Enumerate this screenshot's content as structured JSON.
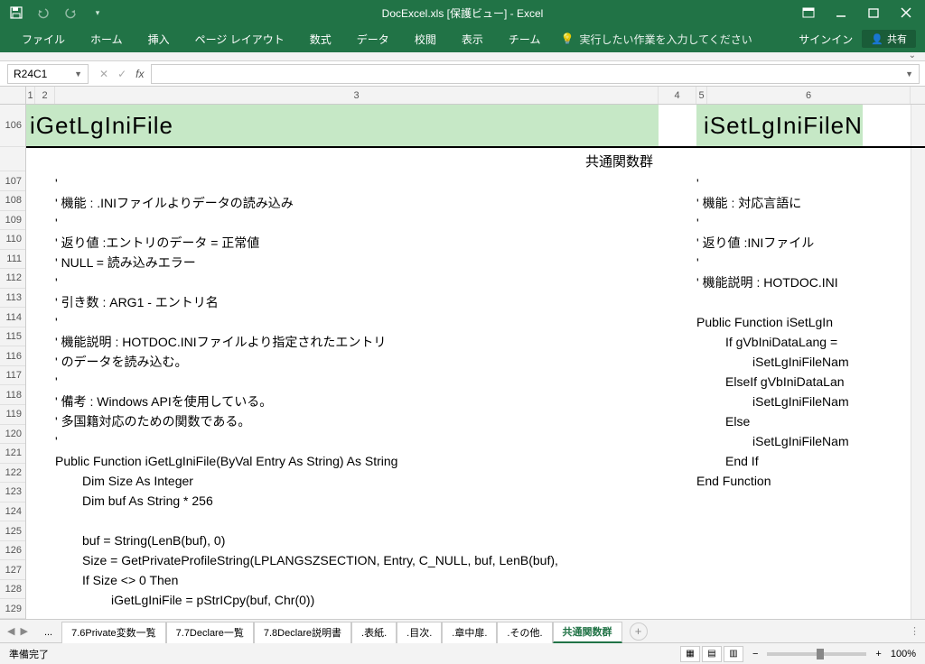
{
  "titlebar": {
    "doc_title": "DocExcel.xls  [保護ビュー] - Excel"
  },
  "ribbon": {
    "tabs": [
      "ファイル",
      "ホーム",
      "挿入",
      "ページ レイアウト",
      "数式",
      "データ",
      "校閲",
      "表示",
      "チーム"
    ],
    "tell_me": "実行したい作業を入力してください",
    "signin": "サインイン",
    "share": "共有"
  },
  "formula": {
    "name_box": "R24C1",
    "fx_value": ""
  },
  "columns": [
    "1",
    "2",
    "3",
    "4",
    "5",
    "6"
  ],
  "rows": [
    "106",
    "107",
    "108",
    "109",
    "110",
    "111",
    "112",
    "113",
    "114",
    "115",
    "116",
    "117",
    "118",
    "119",
    "120",
    "121",
    "122",
    "123",
    "124",
    "125",
    "126",
    "127",
    "128",
    "129"
  ],
  "left_block": {
    "title": "iGetLgIniFile",
    "sub": "共通関数群",
    "lines": [
      "'",
      "' 機能      : .INIファイルよりデータの読み込み",
      "'",
      "' 返り値    :エントリのデータ = 正常値",
      "'            NULL           = 読み込みエラー",
      "'",
      "' 引き数    : ARG1 - エントリ名",
      "'",
      "' 機能説明  : HOTDOC.INIファイルより指定されたエントリ",
      "'             のデータを読み込む。",
      "'",
      "' 備考      : Windows APIを使用している。",
      "'             多国籍対応のための関数である。",
      "'",
      "Public Function iGetLgIniFile(ByVal Entry As String) As String",
      "    Dim Size As Integer",
      "    Dim buf As String * 256",
      "",
      "    buf = String(LenB(buf), 0)",
      "    Size = GetPrivateProfileString(LPLANGSZSECTION, Entry, C_NULL, buf, LenB(buf),",
      "    If Size <> 0 Then",
      "        iGetLgIniFile = pStrICpy(buf, Chr(0))"
    ]
  },
  "right_block": {
    "title": "iSetLgIniFileN",
    "lines": [
      "'",
      "' 機能      : 対応言語に",
      "'",
      "' 返り値    :INIファイル",
      "'",
      "' 機能説明  : HOTDOC.INI",
      "",
      "Public Function iSetLgIn",
      "    If gVbIniDataLang =",
      "        iSetLgIniFileNam",
      "    ElseIf gVbIniDataLan",
      "        iSetLgIniFileNam",
      "    Else",
      "        iSetLgIniFileNam",
      "    End If",
      "End Function"
    ]
  },
  "sheets": [
    "...",
    "7.6Private変数一覧",
    "7.7Declare一覧",
    "7.8Declare説明書",
    ".表紙.",
    ".目次.",
    ".章中扉.",
    ".その他.",
    "共通関数群"
  ],
  "active_sheet": "共通関数群",
  "status": {
    "ready": "準備完了",
    "zoom": "100%"
  }
}
